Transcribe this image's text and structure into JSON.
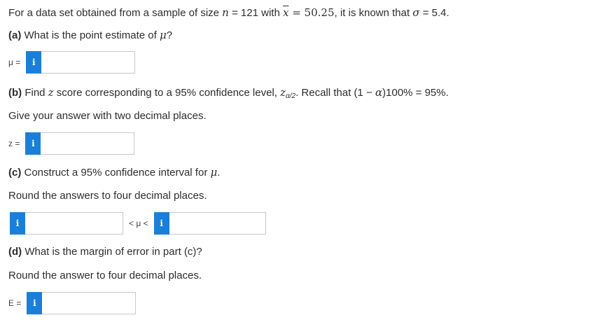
{
  "intro": {
    "prefix": "For a data set obtained from a sample of size ",
    "n_var": "n",
    "n_eq": " = 121 with ",
    "xbar": "x",
    "xbar_eq": " = 50.25",
    "suffix": ", it is known that ",
    "sigma": "σ",
    "sigma_eq": " = 5.4."
  },
  "part_a": {
    "label": "(a)",
    "question": " What is the point estimate of ",
    "mu": "μ",
    "qmark": "?",
    "field_label": "μ =",
    "info_glyph": "i",
    "value": ""
  },
  "part_b": {
    "label": "(b)",
    "q1": " Find ",
    "z": "z",
    "q2": " score corresponding to a 95% confidence level, ",
    "z_sym": "z",
    "z_sub": "α/2",
    "q3": ". Recall that (1 − ",
    "alpha": "α",
    "q4": ")100% = 95%.",
    "instruction": "Give your answer with two decimal places.",
    "field_label": "z =",
    "info_glyph": "i",
    "value": ""
  },
  "part_c": {
    "label": "(c)",
    "question": " Construct a 95% confidence interval for ",
    "mu": "μ",
    "period": ".",
    "instruction": "Round the answers to four decimal places.",
    "between_label": "< μ <",
    "info_glyph": "i",
    "lower_value": "",
    "upper_value": ""
  },
  "part_d": {
    "label": "(d)",
    "question": " What is the margin of error in part (c)?",
    "instruction": "Round the answer to four decimal places.",
    "field_label": "E =",
    "info_glyph": "i",
    "value": ""
  },
  "colors": {
    "info_button": "#1a7fd9",
    "text": "#2d2d2d",
    "input_border": "#c8c8c8"
  }
}
